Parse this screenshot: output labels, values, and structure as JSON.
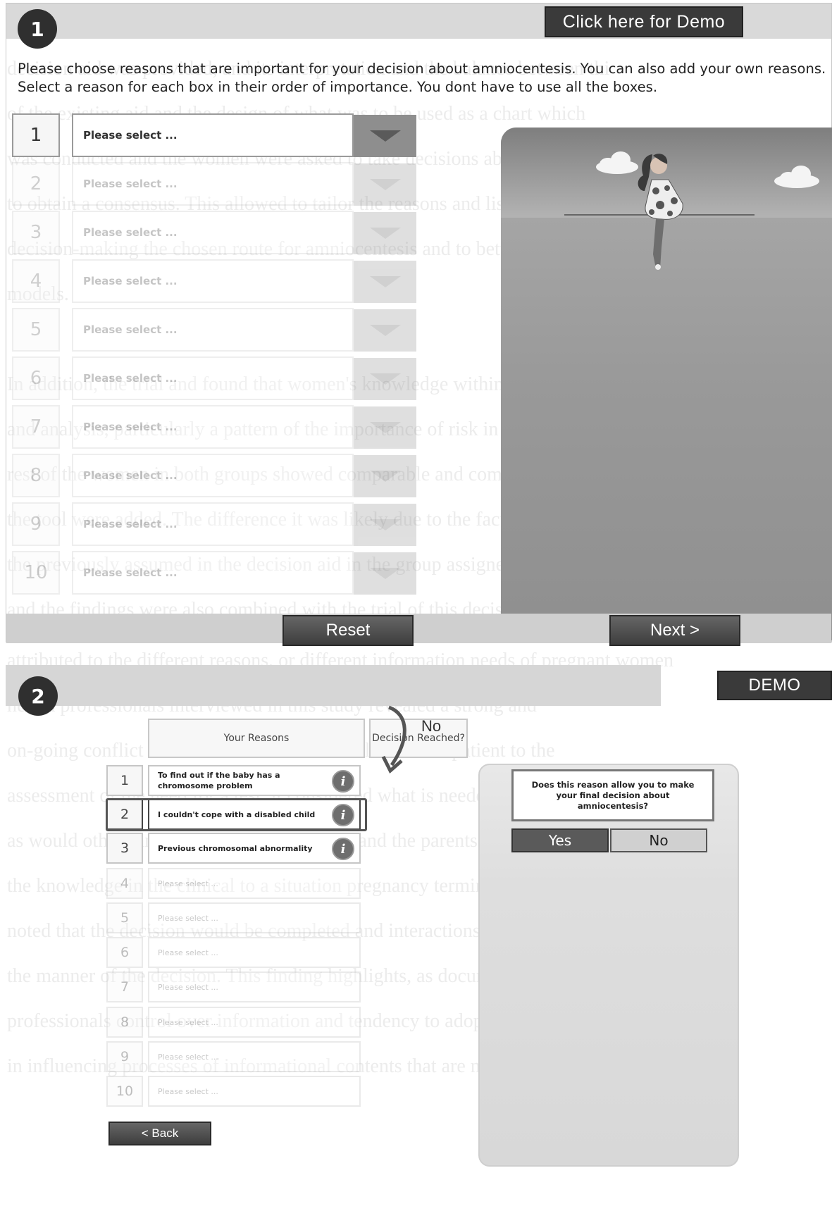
{
  "panel1": {
    "step": "1",
    "demo_button": "Click here for Demo",
    "instructions": "Please choose reasons that are important for your decision about amniocentesis. You can also add your own reasons. Select a reason for each box in their order of importance. You dont have to use all the boxes.",
    "rows": [
      {
        "num": "1",
        "placeholder": "Please select ..."
      },
      {
        "num": "2",
        "placeholder": "Please select ..."
      },
      {
        "num": "3",
        "placeholder": "Please select ..."
      },
      {
        "num": "4",
        "placeholder": "Please select ..."
      },
      {
        "num": "5",
        "placeholder": "Please select ..."
      },
      {
        "num": "6",
        "placeholder": "Please select ..."
      },
      {
        "num": "7",
        "placeholder": "Please select ..."
      },
      {
        "num": "8",
        "placeholder": "Please select ..."
      },
      {
        "num": "9",
        "placeholder": "Please select ..."
      },
      {
        "num": "10",
        "placeholder": "Please select ..."
      }
    ],
    "reset_button": "Reset",
    "next_button": "Next >"
  },
  "panel2": {
    "step": "2",
    "demo_button": "DEMO",
    "header_reasons": "Your Reasons",
    "header_decision": "Decision Reached?",
    "rows": [
      {
        "num": "1",
        "text": "To find out if the baby has a chromosome problem"
      },
      {
        "num": "2",
        "text": "I couldn't cope with a disabled child"
      },
      {
        "num": "3",
        "text": "Previous chromosomal abnormality"
      },
      {
        "num": "4",
        "text": "Please select ..."
      },
      {
        "num": "5",
        "text": "Please select ..."
      },
      {
        "num": "6",
        "text": "Please select ..."
      },
      {
        "num": "7",
        "text": "Please select ..."
      },
      {
        "num": "8",
        "text": "Please select ..."
      },
      {
        "num": "9",
        "text": "Please select ..."
      },
      {
        "num": "10",
        "text": "Please select ..."
      }
    ],
    "decision_no": "No",
    "question": "Does this reason allow you to make your final decision about amniocentesis?",
    "yes_button": "Yes",
    "no_button": "No",
    "back_button": "< Back"
  }
}
